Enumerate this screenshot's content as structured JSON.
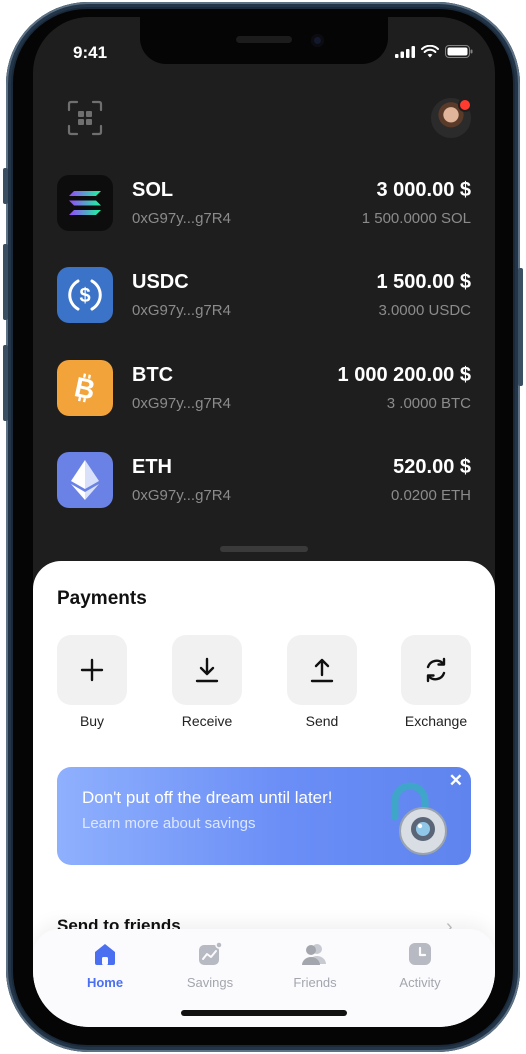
{
  "status_bar": {
    "time": "9:41"
  },
  "assets": [
    {
      "symbol": "SOL",
      "address": "0xG97y...g7R4",
      "value": "3 000.00 $",
      "amount": "1 500.0000 SOL",
      "icon": "solana-icon"
    },
    {
      "symbol": "USDC",
      "address": "0xG97y...g7R4",
      "value": "1 500.00 $",
      "amount": "3.0000 USDC",
      "icon": "usdc-icon"
    },
    {
      "symbol": "BTC",
      "address": "0xG97y...g7R4",
      "value": "1 000 200.00 $",
      "amount": "3 .0000 BTC",
      "icon": "bitcoin-icon"
    },
    {
      "symbol": "ETH",
      "address": "0xG97y...g7R4",
      "value": "520.00 $",
      "amount": "0.0200 ETH",
      "icon": "ethereum-icon"
    }
  ],
  "payments": {
    "title": "Payments",
    "actions": [
      {
        "label": "Buy",
        "icon": "plus-icon"
      },
      {
        "label": "Receive",
        "icon": "download-icon"
      },
      {
        "label": "Send",
        "icon": "upload-icon"
      },
      {
        "label": "Exchange",
        "icon": "exchange-icon"
      }
    ]
  },
  "promo": {
    "title": "Don't put off the dream until later!",
    "subtitle": "Learn more about savings",
    "close": "✕"
  },
  "friends_section": {
    "title": "Send to friends",
    "chevron": "›"
  },
  "tabs": [
    {
      "label": "Home",
      "active": true
    },
    {
      "label": "Savings",
      "active": false
    },
    {
      "label": "Friends",
      "active": false
    },
    {
      "label": "Activity",
      "active": false
    }
  ],
  "colors": {
    "accent": "#4a6ff0",
    "background_dark": "#1e1e1e",
    "notification_dot": "#ff3b30",
    "sol_tile": "#0d0d0d",
    "usdc_tile": "#3a73c7",
    "btc_tile": "#f2a33a",
    "eth_tile": "#6a82e6"
  }
}
